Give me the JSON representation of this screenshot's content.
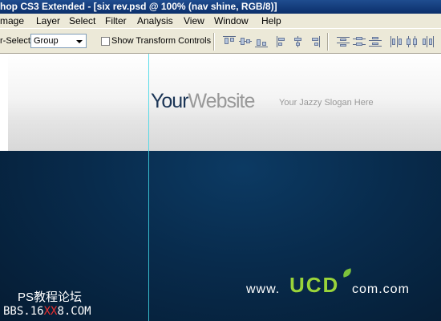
{
  "window": {
    "title": "hop CS3 Extended - [six rev.psd @ 100% (nav shine, RGB/8)]"
  },
  "menu": [
    "mage",
    "Layer",
    "Select",
    "Filter",
    "Analysis",
    "View",
    "Window",
    "Help"
  ],
  "options": {
    "auto_select_label": "r-Select:",
    "auto_select_value": "Group",
    "show_transform_label": "Show Transform Controls",
    "show_transform_checked": false
  },
  "document": {
    "brand_first": "Your",
    "brand_second": "Website",
    "slogan": "Your Jazzy Slogan Here"
  },
  "watermark": {
    "line1": "PS教程论坛",
    "line2_a": "BBS.16",
    "line2_b": "XX",
    "line2_c": "8.COM",
    "ucd_www": "www.",
    "ucd_logo": "UCD",
    "ucd_com": "com.com"
  },
  "colors": {
    "guide": "#3fd7e6",
    "brand": "#1b3556",
    "nav_bg": "#082b4c",
    "logo_green": "#9ad43a"
  }
}
